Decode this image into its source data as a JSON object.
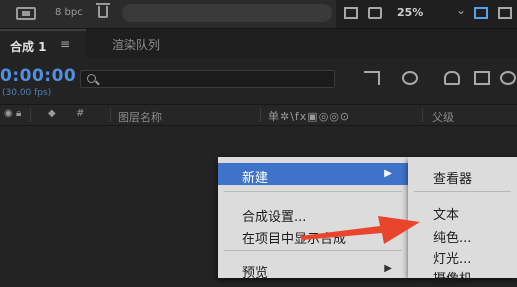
{
  "project_bar": {
    "bit_depth": "8 bpc",
    "zoom": "25%"
  },
  "tabs": {
    "active_label": "合成 1",
    "render_queue": "渲染队列"
  },
  "timeline": {
    "timecode": "0:00:00",
    "fps": "(30.00 fps)",
    "search_placeholder": ""
  },
  "columns": {
    "hash": "#",
    "layer_name": "图层名称",
    "switches": "单✲\\fx▣◎◎⊙",
    "parent": "父级"
  },
  "context_menu": {
    "items": [
      {
        "label": "新建",
        "has_submenu": true,
        "highlighted": true
      },
      {
        "label": "合成设置..."
      },
      {
        "label": "在项目中显示合成"
      },
      {
        "label": "预览",
        "has_submenu": true
      }
    ],
    "submenu_arrow": "▶"
  },
  "submenu": {
    "items": [
      {
        "label": "查看器"
      },
      {
        "label": "文本"
      },
      {
        "label": "纯色..."
      },
      {
        "label": "灯光..."
      },
      {
        "label": "摄像机"
      }
    ]
  },
  "colors": {
    "highlight": "#3e73c9",
    "timecode_blue": "#4f90e0",
    "arrow_red": "#e8452c"
  }
}
